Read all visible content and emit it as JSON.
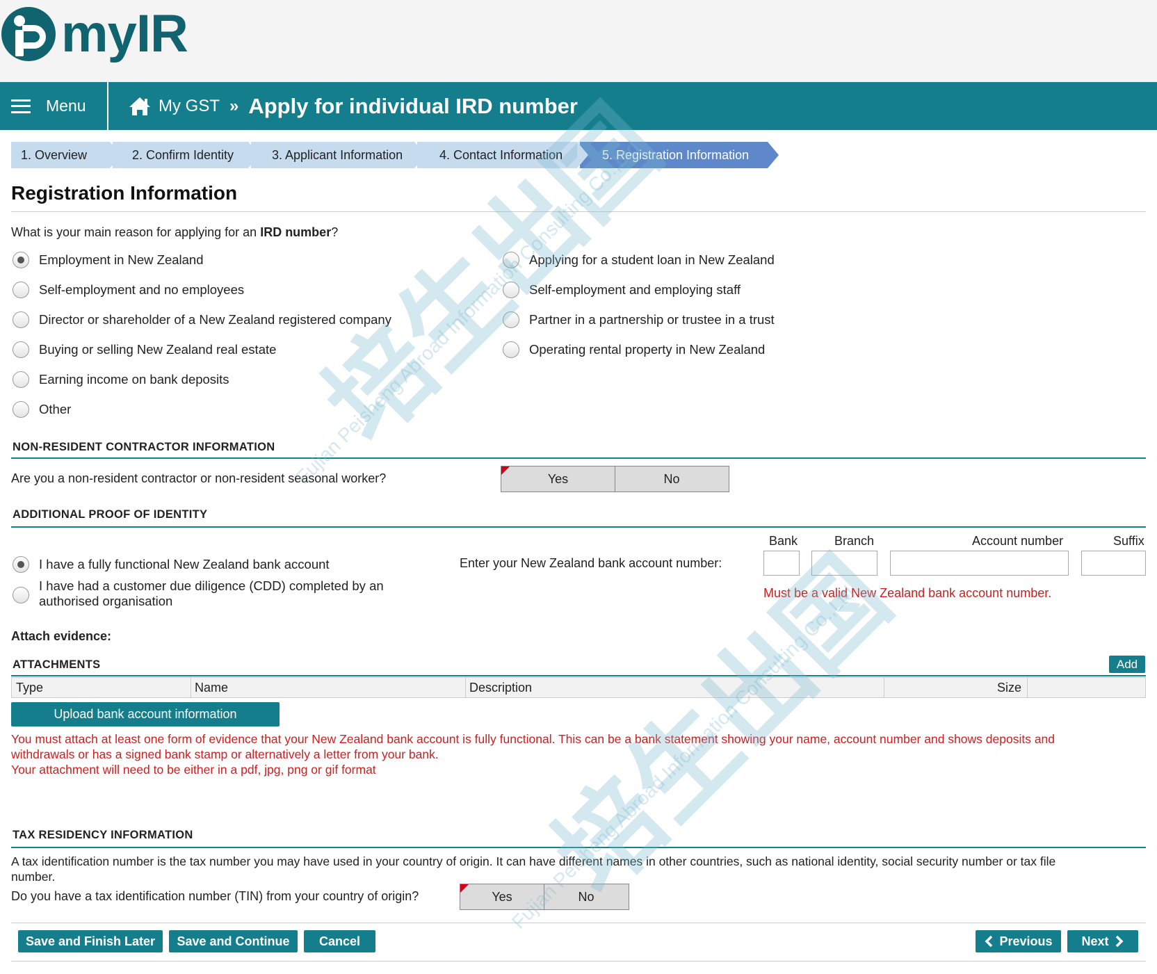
{
  "header": {
    "logo_text": "myIR",
    "menu_label": "Menu",
    "breadcrumb_parent": "My GST",
    "breadcrumb_sep": "»",
    "title": "Apply for individual IRD number"
  },
  "steps": [
    "1. Overview",
    "2. Confirm Identity",
    "3. Applicant Information",
    "4. Contact Information",
    "5. Registration Information"
  ],
  "active_step": 5,
  "page_title": "Registration Information",
  "reason": {
    "question_prefix": "What is your main reason for applying for an",
    "question_bold": "IRD number",
    "question_suffix": "?",
    "options_left": [
      "Employment in New Zealand",
      "Self-employment and no employees",
      "Director or shareholder of a New Zealand registered company",
      "Buying or selling New Zealand real estate",
      "Earning income on bank deposits",
      "Other"
    ],
    "options_right": [
      "Applying for a student loan in New Zealand",
      "Self-employment and employing staff",
      "Partner in a partnership or trustee in a trust",
      "Operating rental property in New Zealand"
    ],
    "selected": "Employment in New Zealand"
  },
  "nonresident": {
    "heading": "NON-RESIDENT CONTRACTOR INFORMATION",
    "question": "Are you a non-resident contractor or non-resident seasonal worker?",
    "yes": "Yes",
    "no": "No"
  },
  "identity": {
    "heading": "ADDITIONAL PROOF OF IDENTITY",
    "option1": "I have a fully functional New Zealand bank account",
    "option2_line1": "I have had a customer due diligence (CDD) completed by an",
    "option2_line2": "authorised organisation",
    "bank_prompt": "Enter your New Zealand bank account number:",
    "bank_label": "Bank",
    "branch_label": "Branch",
    "account_label": "Account number",
    "suffix_label": "Suffix",
    "bank_value": "",
    "branch_value": "",
    "account_value": "",
    "suffix_value": "",
    "error": "Must be a valid New Zealand bank account number."
  },
  "attach": {
    "label": "Attach evidence:",
    "heading": "ATTACHMENTS",
    "add": "Add",
    "columns": [
      "Type",
      "Name",
      "Description",
      "Size"
    ],
    "upload_button": "Upload bank account information",
    "error_line1": "You must attach at least one form of evidence that your New Zealand bank account is fully functional. This can be a bank statement showing your name, account number and shows deposits and",
    "error_line2": "withdrawals or has a signed bank stamp or alternatively a letter from your bank.",
    "error_line3": "Your attachment will need to be either in a pdf, jpg, png or gif format"
  },
  "tax": {
    "heading": "TAX RESIDENCY INFORMATION",
    "info_line1": "A tax identification number is the tax number you may have used in your country of origin. It can have different names in other countries, such as national identity, social security number or tax file",
    "info_line2": "number.",
    "question": "Do you have a tax identification number (TIN) from your country of origin?",
    "yes": "Yes",
    "no": "No"
  },
  "footer": {
    "save_finish_later": "Save and Finish Later",
    "save_continue": "Save and Continue",
    "cancel": "Cancel",
    "previous": "Previous",
    "next": "Next"
  },
  "watermark": {
    "chinese": "培生出国",
    "english": "Fujian Peisheng Abroad Information Consulting Co.,Ltd"
  },
  "colors": {
    "teal": "#157e8c",
    "logo": "#11646f",
    "step_inactive": "#c7dbef",
    "step_active": "#5e88c9",
    "error": "#cc1f1f"
  }
}
